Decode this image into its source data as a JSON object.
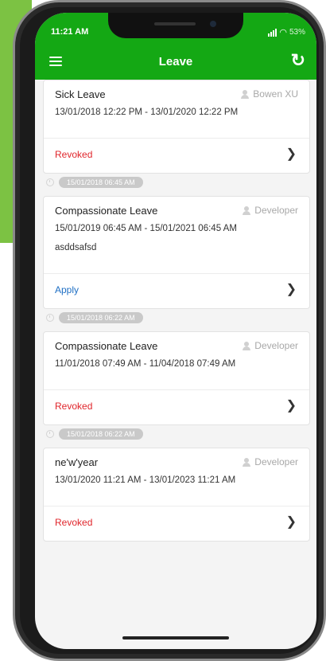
{
  "status_bar": {
    "time": "11:21 AM",
    "battery": "53%"
  },
  "app_bar": {
    "title": "Leave"
  },
  "cards": [
    {
      "title": "Sick Leave",
      "user": "Bowen XU",
      "dates": "13/01/2018 12:22 PM - 13/01/2020 12:22 PM",
      "description": "",
      "status": "Revoked"
    },
    {
      "timestamp": "15/01/2018 06:45 AM",
      "title": "Compassionate Leave",
      "user": "Developer",
      "dates": "15/01/2019 06:45 AM - 15/01/2021 06:45 AM",
      "description": "asddsafsd",
      "status": "Apply"
    },
    {
      "timestamp": "15/01/2018 06:22 AM",
      "title": "Compassionate Leave",
      "user": "Developer",
      "dates": "11/01/2018 07:49 AM - 11/04/2018 07:49 AM",
      "description": "",
      "status": "Revoked"
    },
    {
      "timestamp": "15/01/2018 06:22 AM",
      "title": "ne'w'year",
      "user": "Developer",
      "dates": "13/01/2020 11:21 AM - 13/01/2023 11:21 AM",
      "description": "",
      "status": "Revoked"
    }
  ],
  "colors": {
    "header": "#14a814",
    "revoked": "#e0252b",
    "apply": "#1e6fc4",
    "side_panel": "#7cc243"
  },
  "icons": [
    "menu-icon",
    "refresh-icon",
    "user-icon",
    "clock-icon",
    "chevron-right-icon",
    "signal-icon",
    "wifi-icon"
  ]
}
